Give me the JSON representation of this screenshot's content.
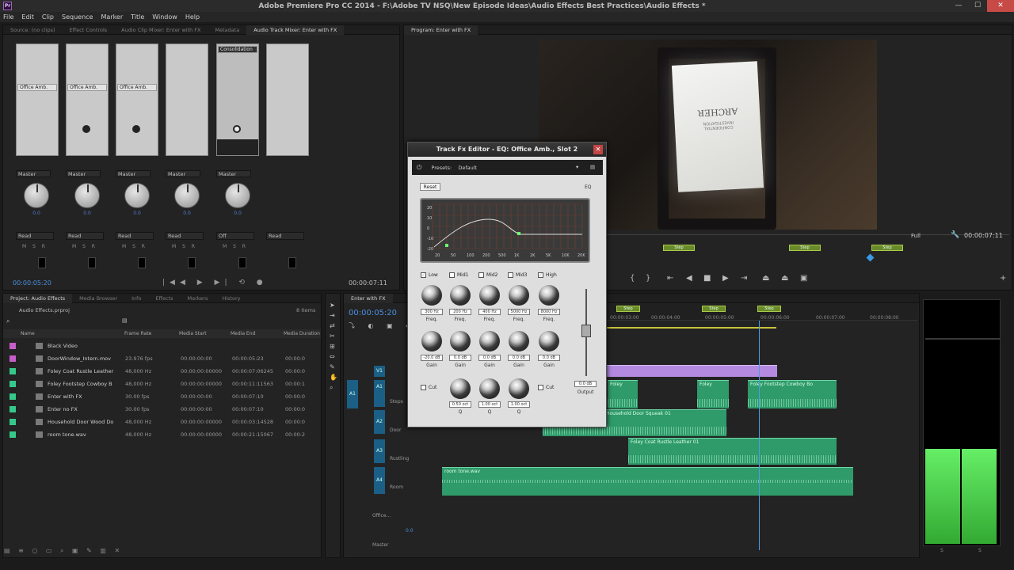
{
  "window": {
    "title": "Adobe Premiere Pro CC 2014 - F:\\Adobe TV NSQ\\New Episode Ideas\\Audio Effects Best Practices\\Audio Effects *",
    "app_icon": "Pr",
    "min": "—",
    "max": "☐",
    "close": "✕"
  },
  "menu": [
    "File",
    "Edit",
    "Clip",
    "Sequence",
    "Marker",
    "Title",
    "Window",
    "Help"
  ],
  "top_left_tabs": [
    "Source: (no clips)",
    "Effect Controls",
    "Audio Clip Mixer: Enter with FX",
    "Metadata",
    "Audio Track Mixer: Enter with FX"
  ],
  "program_tab": "Program: Enter with FX",
  "mixer": {
    "channels": [
      {
        "slot": "Office Amb.",
        "route": "Master",
        "pan": "0.0",
        "auto": "Read",
        "knob_val": ""
      },
      {
        "slot": "Office Amb.",
        "route": "Master",
        "pan": "0.0",
        "auto": "Read",
        "knob_val": "0.0"
      },
      {
        "slot": "Office Amb.",
        "route": "Master",
        "pan": "0.0",
        "auto": "Read",
        "knob_val": "0.0"
      },
      {
        "slot": "",
        "route": "Master",
        "pan": "0.0",
        "auto": "Read",
        "knob_val": ""
      },
      {
        "slot": "Consolidation",
        "route": "Master",
        "pan": "0.0",
        "auto": "Off",
        "knob_val": "0.0"
      },
      {
        "slot": "",
        "route": "",
        "pan": "",
        "auto": "Read",
        "knob_val": ""
      }
    ],
    "msr": "M S R",
    "timecode_left": "00:00:05:20",
    "timecode_right": "00:00:07:11"
  },
  "program": {
    "paper_title": "ARCHER",
    "paper_sub": "CONFIDENTIAL INVESTIGATION",
    "markers": [
      "Step",
      "Step",
      "Step"
    ],
    "fit": "Full",
    "timecode": "00:00:07:11"
  },
  "fx": {
    "title": "Track Fx Editor - EQ: Office Amb., Slot 2",
    "close": "✕",
    "presets_label": "Presets:",
    "preset": "Default",
    "reset": "Reset",
    "eq": "EQ",
    "x_ticks": [
      "20",
      "50",
      "100",
      "200",
      "500",
      "1K",
      "2K",
      "5K",
      "10K",
      "20K"
    ],
    "y_ticks": [
      "20",
      "10",
      "0",
      "-10",
      "-20"
    ],
    "bands": [
      "Low",
      "Mid1",
      "Mid2",
      "Mid3",
      "High"
    ],
    "freq": [
      "300 Hz",
      "200 Hz",
      "400 Hz",
      "5000 Hz",
      "8000 Hz"
    ],
    "gain": [
      "-20.0 dB",
      "0.0 dB",
      "0.0 dB",
      "0.0 dB",
      "0.0 dB"
    ],
    "q": [
      "0.50 oct",
      "1.00 oct",
      "1.00 oct"
    ],
    "freq_label": "Freq.",
    "gain_label": "Gain",
    "q_label": "Q",
    "cut": "Cut",
    "output_val": "0.0 dB",
    "output": "Output"
  },
  "project": {
    "tabs": [
      "Project: Audio Effects",
      "Media Browser",
      "Info",
      "Effects",
      "Markers",
      "History"
    ],
    "file": "Audio Effects.prproj",
    "count": "8 Items",
    "headers": [
      "Name",
      "Frame Rate",
      "Media Start",
      "Media End",
      "Media Duration"
    ],
    "rows": [
      {
        "name": "Black Video",
        "rate": "",
        "start": "",
        "end": "",
        "dur": "",
        "color": "#c45ec8"
      },
      {
        "name": "DoorWindow_Intern.mov",
        "rate": "23.976 fps",
        "start": "00:00:00:00",
        "end": "00:00:05:23",
        "dur": "00:00:0",
        "color": "#c45ec8"
      },
      {
        "name": "Foley Coat Rustle Leather",
        "rate": "48,000 Hz",
        "start": "00:00:00:00000",
        "end": "00:00:07:06245",
        "dur": "00:00:0",
        "color": "#36c88a"
      },
      {
        "name": "Foley Footstep Cowboy B",
        "rate": "48,000 Hz",
        "start": "00:00:00:00000",
        "end": "00:00:11:11563",
        "dur": "00:00:1",
        "color": "#36c88a"
      },
      {
        "name": "Enter with FX",
        "rate": "30.00 fps",
        "start": "00:00:00:00",
        "end": "00:00:07:10",
        "dur": "00:00:0",
        "color": "#36c88a"
      },
      {
        "name": "Enter no FX",
        "rate": "30.00 fps",
        "start": "00:00:00:00",
        "end": "00:00:07:10",
        "dur": "00:00:0",
        "color": "#36c88a"
      },
      {
        "name": "Household Door Wood Do",
        "rate": "48,000 Hz",
        "start": "00:00:00:00000",
        "end": "00:00:03:14528",
        "dur": "00:00:0",
        "color": "#36c88a"
      },
      {
        "name": "room tone.wav",
        "rate": "48,000 Hz",
        "start": "00:00:00:00000",
        "end": "00:00:21:15067",
        "dur": "00:00:2",
        "color": "#36c88a"
      }
    ]
  },
  "timeline": {
    "tab": "Enter with FX",
    "timecode": "00:00:05:20",
    "ruler": [
      "00:00:03:00",
      "00:00:04:00",
      "00:00:05:00",
      "00:00:06:00",
      "00:00:07:00",
      "00:00:08:00"
    ],
    "markers": [
      "Step",
      "Step",
      "Step"
    ],
    "tracks": [
      "V1",
      "A1",
      "A2",
      "A3",
      "A4"
    ],
    "track_names": [
      "",
      "Steps",
      "Door",
      "Rustling",
      "Room"
    ],
    "submix": "Office...",
    "master": "Master",
    "submix_val": "0.0",
    "clips": {
      "foley1": "Foley",
      "foley2": "Foley",
      "foley3": "Foley Footstep Cowboy Bo",
      "door": "Household Door Squeak 01",
      "coat": "Foley Coat Rustle Leather 01",
      "room": "room tone.wav"
    }
  },
  "meters": {
    "scale": [
      "S",
      "S"
    ]
  }
}
